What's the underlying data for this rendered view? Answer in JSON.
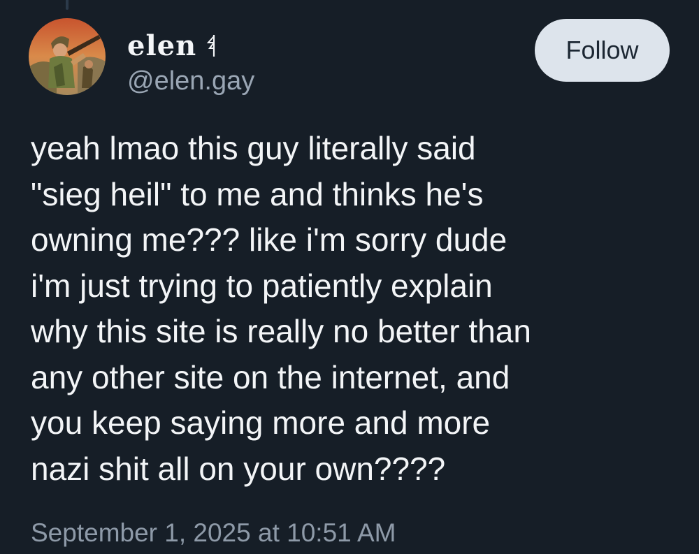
{
  "post": {
    "author": {
      "display_name": "elen",
      "name_glyph_icon": "flag-glyph-icon",
      "handle": "@elen.gay",
      "avatar_icon": "avatar-soldier-illustration"
    },
    "follow_label": "Follow",
    "text_lines": [
      "yeah lmao this guy literally said",
      "\"sieg heil\" to me and thinks he's",
      "owning me??? like i'm sorry dude",
      "i'm just trying to patiently explain",
      "why this site is really no better than",
      "any other site on the internet, and",
      "you keep saying more and more",
      "nazi shit all on your own????"
    ],
    "timestamp": "September 1, 2025 at 10:51 AM"
  },
  "colors": {
    "background": "#161e27",
    "follow_button_bg": "#dde4ec",
    "follow_button_text": "#1c2733",
    "handle": "#9aa6b4",
    "timestamp": "#8e9aa8"
  }
}
